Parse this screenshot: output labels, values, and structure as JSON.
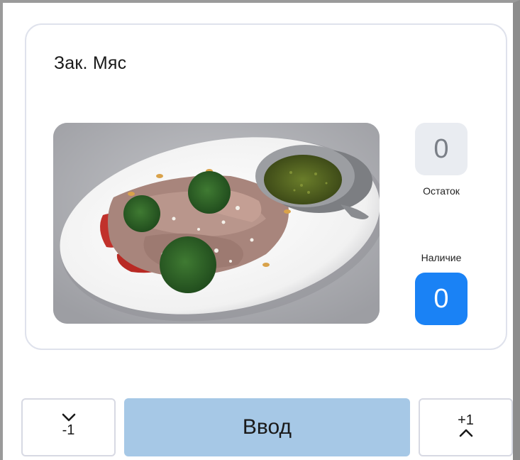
{
  "product": {
    "name": "Зак. Мяс",
    "image_alt": "dish-photo"
  },
  "counters": {
    "rest": {
      "label": "Остаток",
      "value": "0"
    },
    "available": {
      "label": "Наличие",
      "value": "0"
    }
  },
  "actions": {
    "decrement_label": "-1",
    "enter_label": "Ввод",
    "increment_label": "+1"
  },
  "colors": {
    "accent": "#1a82f5",
    "enter_button": "#a6c8e6",
    "counter_muted_bg": "#e9ecf1",
    "card_border": "#dfe2ec"
  }
}
